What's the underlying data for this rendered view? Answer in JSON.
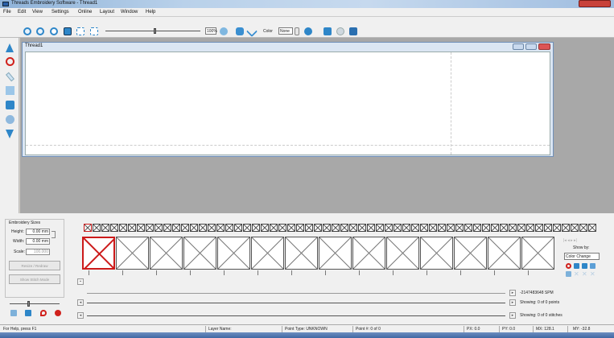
{
  "window": {
    "title": "Threads Embroidery Software - Thread1"
  },
  "menu": [
    "File",
    "Edit",
    "View",
    "Settings",
    "Online",
    "Layout",
    "Window",
    "Help"
  ],
  "toolbar": {
    "zoom_value": "100%",
    "color_label": "Color",
    "color_value": "None"
  },
  "document": {
    "title": "Thread1"
  },
  "embroidery_size": {
    "group_label": "Embroidery Sizes",
    "height_label": "Height:",
    "height_value": "0.00 mm",
    "width_label": "Width:",
    "width_value": "0.00 mm",
    "scale_label": "Scale:",
    "scale_value": "100.000",
    "resize_button": "Resize / Redraw",
    "show_stitch_button": "Show Stitch Mode"
  },
  "right_panel": {
    "show_by_label": "Show by:",
    "show_by_value": "Color Change",
    "stitch_count": "-2147483648 SPM",
    "showing_points": "Showing: 0 of 0 points",
    "showing_stitches": "Showing: 0 of 0 stitches"
  },
  "statusbar": {
    "help": "For Help, press F1",
    "layer": "Layer Name:",
    "point_type": "Point Type: UNKNOWN",
    "point_index": "Point #: 0 of 0",
    "px": "PX: 0.0",
    "py": "PY: 0.0",
    "mx": "MX: 128.1",
    "my": "MY: -32.8"
  },
  "colors": {
    "accent_blue": "#2e86c8",
    "record_red": "#d0211c",
    "selection_red": "#cc1a1a",
    "workspace_gray": "#a8a8a8"
  }
}
